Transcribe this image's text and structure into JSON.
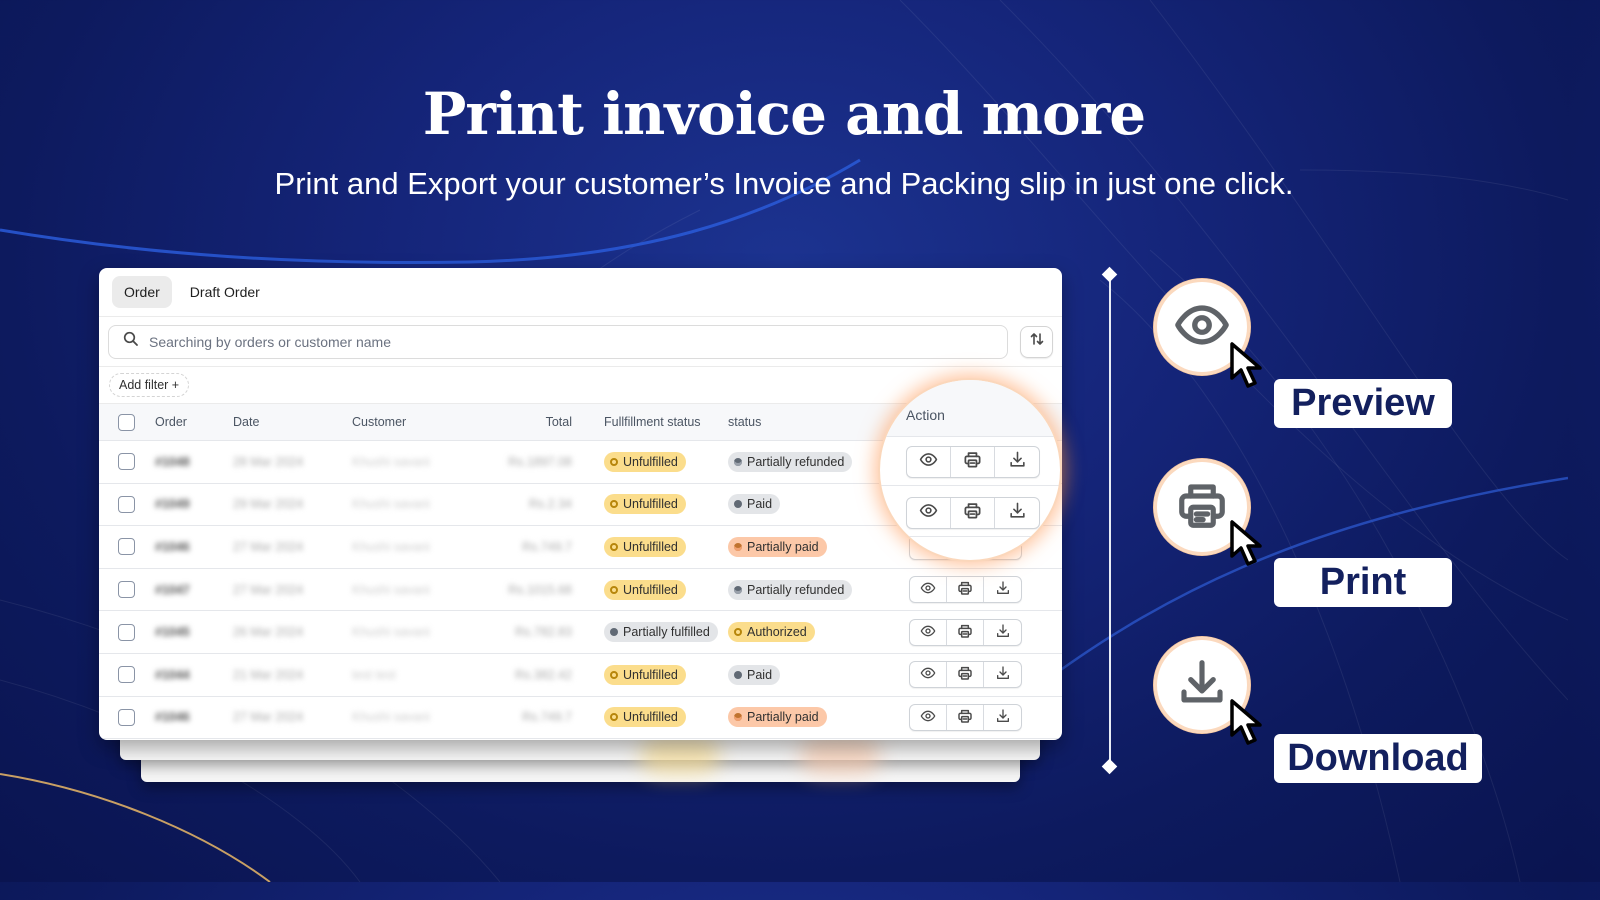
{
  "hero": {
    "title": "Print invoice and more",
    "subtitle": "Print and Export your customer’s Invoice  and Packing slip in just one click."
  },
  "colors": {
    "background": "#13237a",
    "label_text": "#13205e",
    "badge_yellow": "#fbdd8c",
    "badge_gray": "#e3e5e8",
    "badge_orange": "#fcc8a8",
    "glow": "#ff9650"
  },
  "tabs": [
    {
      "label": "Order",
      "active": true
    },
    {
      "label": "Draft Order",
      "active": false
    }
  ],
  "search": {
    "placeholder": "Searching by orders or customer name",
    "value": "",
    "icon": "search-icon",
    "sort_icon": "sort-arrows-icon"
  },
  "filter": {
    "add_filter_label": "Add filter +"
  },
  "table": {
    "columns": [
      "Order",
      "Date",
      "Customer",
      "Total",
      "Fullfillment status",
      "status",
      "Action"
    ],
    "rows": [
      {
        "order": "#1048",
        "date": "28 Mar 2024",
        "customer": "Khushi savani",
        "total": "Rs.1897.08",
        "fulfillment": "Unfulfilled",
        "payment": "Partially refunded"
      },
      {
        "order": "#1049",
        "date": "29 Mar 2024",
        "customer": "Khushi savani",
        "total": "Rs.2.34",
        "fulfillment": "Unfulfilled",
        "payment": "Paid"
      },
      {
        "order": "#1046",
        "date": "27 Mar 2024",
        "customer": "Khushi savani",
        "total": "Rs.749.7",
        "fulfillment": "Unfulfilled",
        "payment": "Partially paid"
      },
      {
        "order": "#1047",
        "date": "27 Mar 2024",
        "customer": "Khushi savani",
        "total": "Rs.1015.68",
        "fulfillment": "Unfulfilled",
        "payment": "Partially refunded"
      },
      {
        "order": "#1045",
        "date": "26 Mar 2024",
        "customer": "Khushi savani",
        "total": "Rs.782.83",
        "fulfillment": "Partially fulfilled",
        "payment": "Authorized"
      },
      {
        "order": "#1044",
        "date": "21 Mar 2024",
        "customer": "test test",
        "total": "Rs.382.42",
        "fulfillment": "Unfulfilled",
        "payment": "Paid"
      },
      {
        "order": "#1046",
        "date": "27 Mar 2024",
        "customer": "Khushi savani",
        "total": "Rs.749.7",
        "fulfillment": "Unfulfilled",
        "payment": "Partially paid"
      }
    ],
    "action_icons": [
      "eye-icon",
      "printer-icon",
      "download-icon"
    ]
  },
  "magnifier": {
    "title": "Action"
  },
  "features": [
    {
      "label": "Preview",
      "icon": "eye-icon"
    },
    {
      "label": "Print",
      "icon": "printer-icon"
    },
    {
      "label": "Download",
      "icon": "download-icon"
    }
  ]
}
